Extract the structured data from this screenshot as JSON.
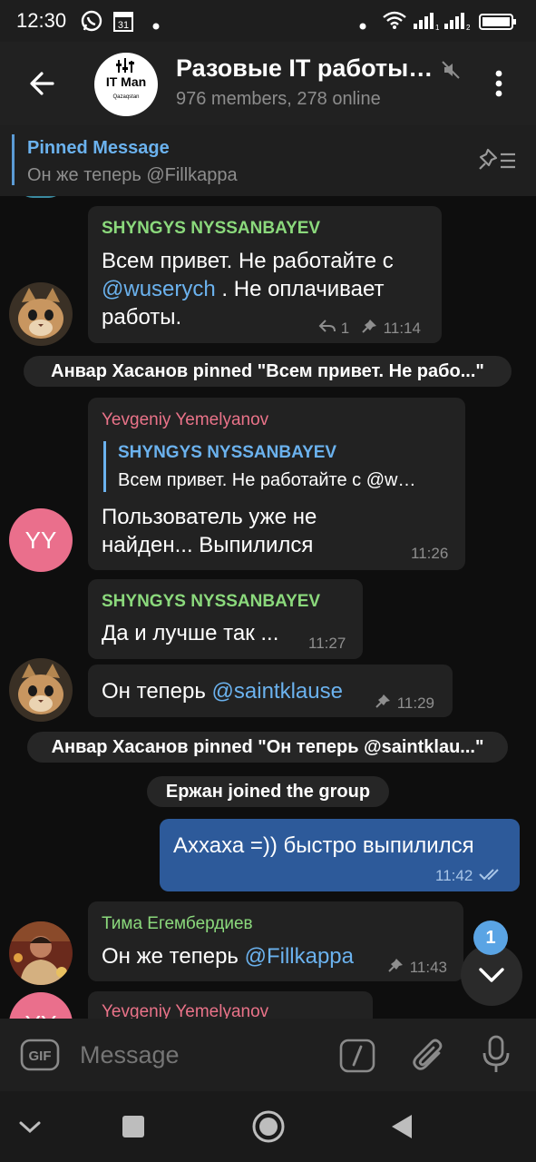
{
  "status": {
    "time": "12:30"
  },
  "header": {
    "title": "Разовые IT работы…",
    "members": "976 members, 278 online",
    "logo_text": "IT Man",
    "logo_sub": "Qazaqstan"
  },
  "pinned": {
    "label": "Pinned Message",
    "text": "Он же теперь @Fillkappa"
  },
  "messages": {
    "m1": {
      "name": "SHYNGYS NYSSANBAYEV",
      "line1": "Всем привет. Не работайте с",
      "link": "@wuserych",
      "line2_rest": " . Не оплачивает",
      "line3": "работы.",
      "replies": "1",
      "time": "11:14"
    },
    "service1": "Анвар Хасанов pinned \"Всем привет. Не рабо...\"",
    "m2": {
      "name": "Yevgeniy Yemelyanov",
      "avatar": "YY",
      "quote_name": "SHYNGYS NYSSANBAYEV",
      "quote_text": "Всем привет. Не работайте с @w…",
      "line1": "Пользователь уже не",
      "line2": "найден... Выпилился",
      "time": "11:26"
    },
    "m3": {
      "name": "SHYNGYS NYSSANBAYEV",
      "text": "Да и лучше так ...",
      "time": "11:27"
    },
    "m4": {
      "text_prefix": "Он теперь ",
      "link": "@saintklause",
      "time": "11:29"
    },
    "service2": "Анвар Хасанов pinned \"Он теперь @saintklau...\"",
    "service3": "Ержан joined the group",
    "m5": {
      "text": "Аххаха =)) быстро выпилился",
      "time": "11:42"
    },
    "m6": {
      "name": "Тима Егембердиев",
      "text_prefix": "Он же теперь ",
      "link": "@Fillkappa",
      "time": "11:43"
    },
    "m7": {
      "name": "Yevgeniy Yemelyanov",
      "avatar": "YY"
    }
  },
  "unread_badge": "1",
  "composer": {
    "placeholder": "Message"
  },
  "colors": {
    "green_name": "#8bd97c",
    "pink_name": "#ea7389",
    "link": "#6bb2ee",
    "outgoing_bubble": "#2d5a9a",
    "incoming_bubble": "#222222",
    "yy_avatar": "#ea6f8c"
  }
}
